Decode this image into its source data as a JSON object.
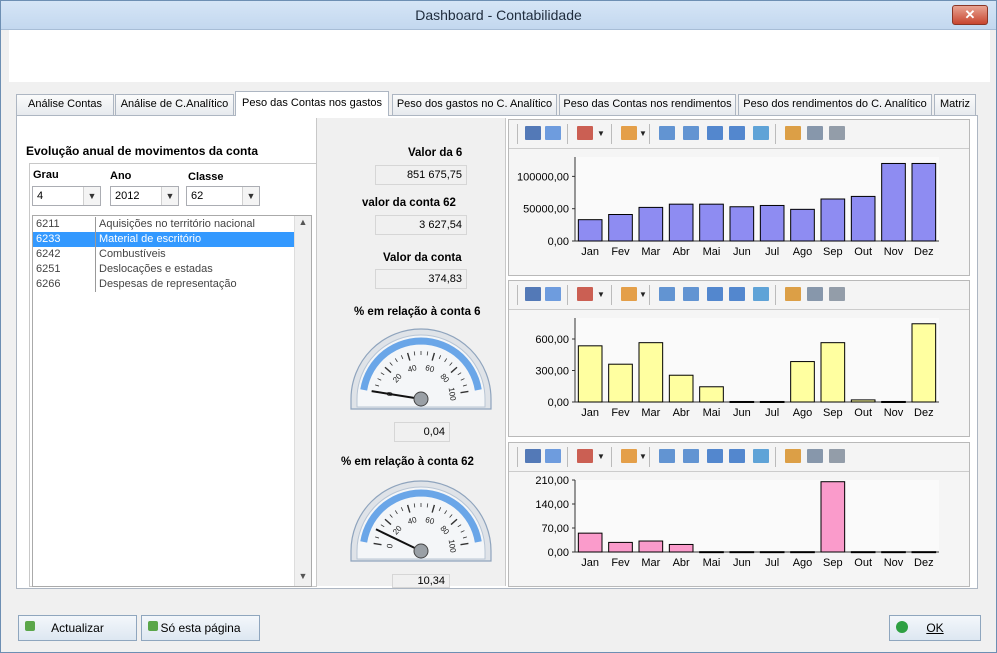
{
  "window": {
    "title": "Dashboard - Contabilidade",
    "close_label": "✕"
  },
  "tabs": [
    {
      "label": "Análise Contas"
    },
    {
      "label": "Análise de C.Analítico"
    },
    {
      "label": "Peso das Contas nos gastos",
      "active": true
    },
    {
      "label": "Peso dos gastos no C. Analítico"
    },
    {
      "label": "Peso das Contas nos rendimentos"
    },
    {
      "label": "Peso dos rendimentos do C. Analítico"
    },
    {
      "label": "Matriz"
    }
  ],
  "left": {
    "section_title": "Evolução anual de movimentos da conta",
    "grau": {
      "label": "Grau",
      "value": "4"
    },
    "ano": {
      "label": "Ano",
      "value": "2012"
    },
    "classe": {
      "label": "Classe",
      "value": "62"
    },
    "accounts": [
      {
        "code": "6211",
        "name": "Aquisições no território nacional"
      },
      {
        "code": "6233",
        "name": "Material de escritório",
        "selected": true
      },
      {
        "code": "6242",
        "name": "Combustíveis"
      },
      {
        "code": "6251",
        "name": "Deslocações e estadas"
      },
      {
        "code": "6266",
        "name": "Despesas de representação"
      }
    ]
  },
  "middle": {
    "valor6": {
      "label": "Valor da 6",
      "value": "851 675,75"
    },
    "valor62": {
      "label": "valor da conta 62",
      "value": "3 627,54"
    },
    "valorConta": {
      "label": "Valor da conta",
      "value": "374,83"
    },
    "gauge1": {
      "label": "% em relação à conta 6",
      "value": "0,04",
      "level": 0.04
    },
    "gauge2": {
      "label": "% em relação à conta 62",
      "value": "10,34",
      "level": 10.34
    },
    "gauge_ticks": [
      "0",
      "20",
      "40",
      "60",
      "80",
      "100"
    ]
  },
  "chart_data": [
    {
      "type": "bar",
      "categories": [
        "Jan",
        "Fev",
        "Mar",
        "Abr",
        "Mai",
        "Jun",
        "Jul",
        "Ago",
        "Sep",
        "Out",
        "Nov",
        "Dez"
      ],
      "values": [
        33000,
        41000,
        52000,
        57000,
        57000,
        53000,
        55000,
        49000,
        65000,
        69000,
        120000,
        120000
      ],
      "ylim": [
        0,
        130000
      ],
      "yticks": [
        0,
        50000,
        100000
      ],
      "ytick_labels": [
        "0,00",
        "50000,00",
        "100000,00"
      ],
      "color": "#8e8cf2"
    },
    {
      "type": "bar",
      "categories": [
        "Jan",
        "Fev",
        "Mar",
        "Abr",
        "Mai",
        "Jun",
        "Jul",
        "Ago",
        "Sep",
        "Out",
        "Nov",
        "Dez"
      ],
      "values": [
        535,
        360,
        565,
        255,
        145,
        5,
        5,
        385,
        565,
        20,
        5,
        745
      ],
      "ylim": [
        0,
        800
      ],
      "yticks": [
        0,
        300,
        600
      ],
      "ytick_labels": [
        "0,00",
        "300,00",
        "600,00"
      ],
      "color": "#ffffa0"
    },
    {
      "type": "bar",
      "categories": [
        "Jan",
        "Fev",
        "Mar",
        "Abr",
        "Mai",
        "Jun",
        "Jul",
        "Ago",
        "Sep",
        "Out",
        "Nov",
        "Dez"
      ],
      "values": [
        55,
        28,
        32,
        22,
        1,
        1,
        1,
        1,
        205,
        1,
        1,
        1
      ],
      "ylim": [
        0,
        210
      ],
      "yticks": [
        0,
        70,
        140,
        210
      ],
      "ytick_labels": [
        "0,00",
        "70,00",
        "140,00",
        "210,00"
      ],
      "color": "#fa9bcb"
    }
  ],
  "icons": [
    "save-icon",
    "copy-icon",
    "chart-type-icon",
    "palette-icon",
    "report-icon",
    "report2-icon",
    "list-icon",
    "grid-icon",
    "image-icon",
    "zoom-icon",
    "preview-icon",
    "print-icon"
  ],
  "footer": {
    "actualizar": "Actualizar",
    "so_esta": "Só esta página",
    "ok": "OK"
  }
}
